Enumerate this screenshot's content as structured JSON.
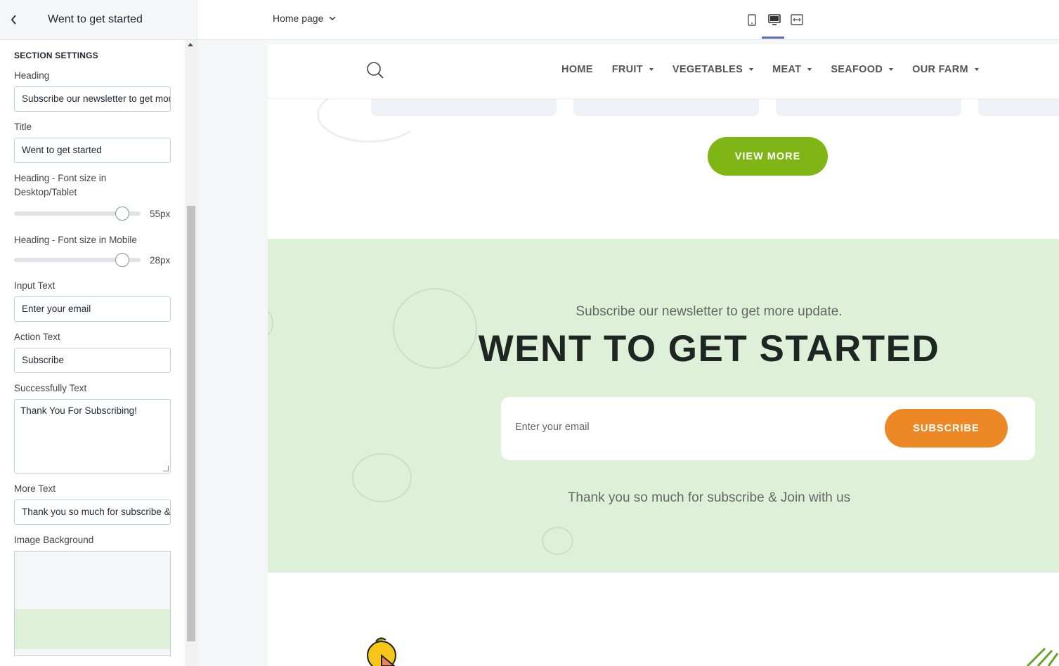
{
  "editor": {
    "header_title": "Went to get started",
    "section_label": "SECTION SETTINGS",
    "fields": {
      "heading_label": "Heading",
      "heading_value": "Subscribe our newsletter to get more update.",
      "title_label": "Title",
      "title_value": "Went to get started",
      "heading_font_desktop_label": "Heading - Font size in Desktop/Tablet",
      "heading_font_desktop_value": "55px",
      "heading_font_desktop_level": 0.86,
      "heading_font_mobile_label": "Heading - Font size in Mobile",
      "heading_font_mobile_value": "28px",
      "heading_font_mobile_level": 0.86,
      "input_text_label": "Input Text",
      "input_text_value": "Enter your email",
      "action_text_label": "Action Text",
      "action_text_value": "Subscribe",
      "success_text_label": "Successfully Text",
      "success_text_value": "Thank You For Subscribing!",
      "more_text_label": "More Text",
      "more_text_value": "Thank you so much for subscribe & Join with us",
      "image_bg_label": "Image Background"
    }
  },
  "topbar": {
    "page_select": "Home page",
    "devices": [
      "mobile-icon",
      "desktop-icon",
      "full-width-icon"
    ],
    "active_device": "desktop"
  },
  "store": {
    "nav": [
      {
        "label": "HOME",
        "has_caret": false
      },
      {
        "label": "FRUIT",
        "has_caret": true
      },
      {
        "label": "VEGETABLES",
        "has_caret": true
      },
      {
        "label": "MEAT",
        "has_caret": true
      },
      {
        "label": "SEAFOOD",
        "has_caret": true
      },
      {
        "label": "OUR FARM",
        "has_caret": true
      }
    ],
    "view_more": "VIEW MORE",
    "newsletter": {
      "subheading": "Subscribe our newsletter to get more update.",
      "heading": "WENT TO GET STARTED",
      "input_placeholder": "Enter your email",
      "button": "SUBSCRIBE",
      "more_text": "Thank you so much for subscribe & Join with us"
    }
  },
  "colors": {
    "accent_green": "#7fb514",
    "accent_orange": "#ec8826",
    "newsletter_bg": "#dff0d8",
    "active_device": "#5c6ac4"
  }
}
